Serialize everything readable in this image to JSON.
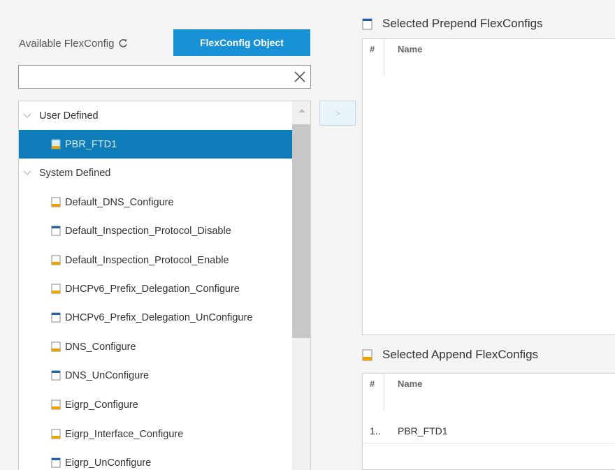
{
  "available": {
    "label": "Available FlexConfig",
    "object_button": "FlexConfig Object",
    "search_placeholder": ""
  },
  "tree": [
    {
      "kind": "group",
      "label": "User Defined"
    },
    {
      "kind": "item",
      "label": "PBR_FTD1",
      "icon": "file-text-icon",
      "selected": true
    },
    {
      "kind": "group",
      "label": "System Defined"
    },
    {
      "kind": "item",
      "label": "Default_DNS_Configure",
      "icon": "file-text-icon"
    },
    {
      "kind": "item",
      "label": "Default_Inspection_Protocol_Disable",
      "icon": "file-blank-icon"
    },
    {
      "kind": "item",
      "label": "Default_Inspection_Protocol_Enable",
      "icon": "file-text-icon"
    },
    {
      "kind": "item",
      "label": "DHCPv6_Prefix_Delegation_Configure",
      "icon": "file-text-icon"
    },
    {
      "kind": "item",
      "label": "DHCPv6_Prefix_Delegation_UnConfigure",
      "icon": "file-blank-icon"
    },
    {
      "kind": "item",
      "label": "DNS_Configure",
      "icon": "file-text-icon"
    },
    {
      "kind": "item",
      "label": "DNS_UnConfigure",
      "icon": "file-blank-icon"
    },
    {
      "kind": "item",
      "label": "Eigrp_Configure",
      "icon": "file-text-icon"
    },
    {
      "kind": "item",
      "label": "Eigrp_Interface_Configure",
      "icon": "file-text-icon"
    },
    {
      "kind": "item",
      "label": "Eigrp_UnConfigure",
      "icon": "file-blank-icon"
    }
  ],
  "move_button": ">",
  "prepend": {
    "title": "Selected Prepend FlexConfigs",
    "col_num": "#",
    "col_name": "Name",
    "rows": []
  },
  "append": {
    "title": "Selected Append FlexConfigs",
    "col_num": "#",
    "col_name": "Name",
    "rows": [
      {
        "num": "1..",
        "name": "PBR_FTD1"
      }
    ]
  },
  "colors": {
    "accent": "#1991d6",
    "selected_row": "#0e7cb8",
    "icon_orange": "#f0a300",
    "icon_blue": "#1f5fa8"
  }
}
